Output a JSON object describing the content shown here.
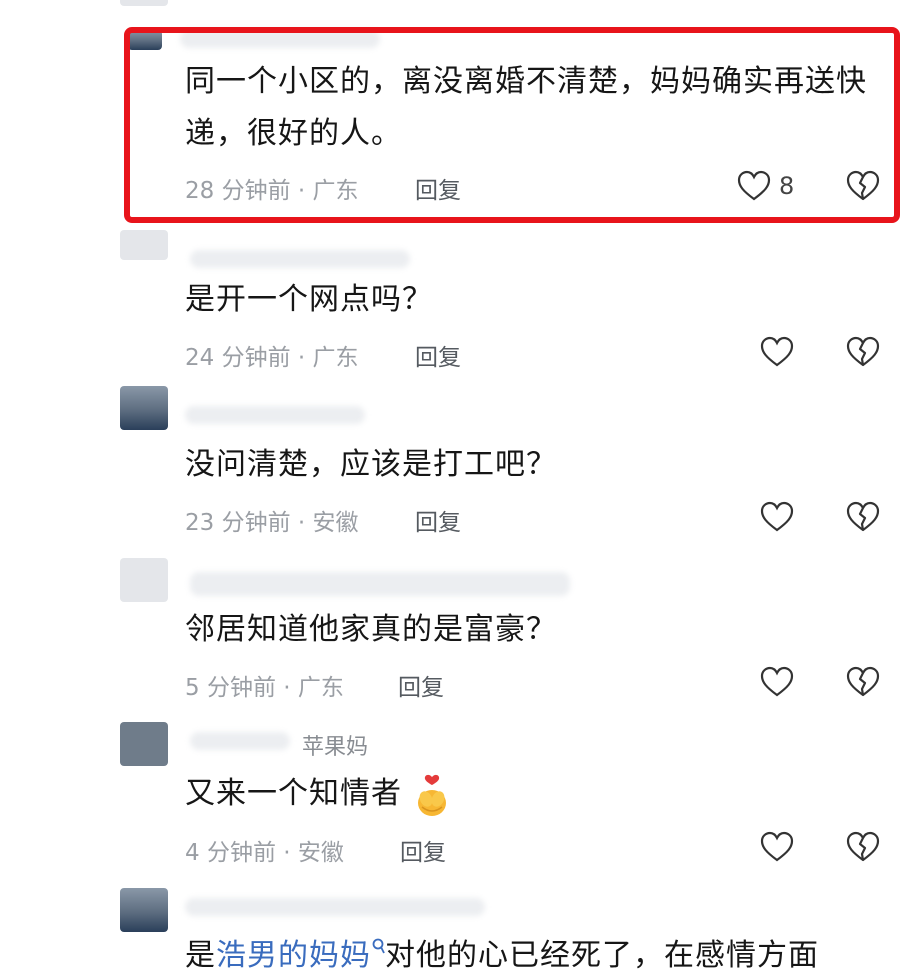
{
  "comments": [
    {
      "text_line1": "同一个小区的，离没离婚不清楚，妈妈确实再送快",
      "text_line2": "递，很好的人。",
      "meta": "28 分钟前 · 广东",
      "reply": "回复",
      "likes": "8"
    },
    {
      "text": "是开一个网点吗？",
      "meta": "24 分钟前 · 广东",
      "reply": "回复"
    },
    {
      "text": "没问清楚，应该是打工吧？",
      "meta": "23 分钟前 · 安徽",
      "reply": "回复"
    },
    {
      "text": "邻居知道他家真的是富豪？",
      "meta": "5 分钟前 · 广东",
      "reply": "回复"
    },
    {
      "user": "苹果妈",
      "text": "又来一个知情者",
      "meta": "4 分钟前 · 安徽",
      "reply": "回复"
    },
    {
      "text_prefix": "是",
      "mention": "浩男的妈妈",
      "text_suffix": "对他的心已经死了，在感情方面"
    }
  ],
  "colors": {
    "highlight_border": "#e8141b",
    "mention": "#3a6cbe",
    "meta": "#9a9ea4"
  },
  "icons": [
    "heart-outline-icon",
    "broken-heart-icon",
    "hug-emoji-icon",
    "at-mention-icon"
  ]
}
